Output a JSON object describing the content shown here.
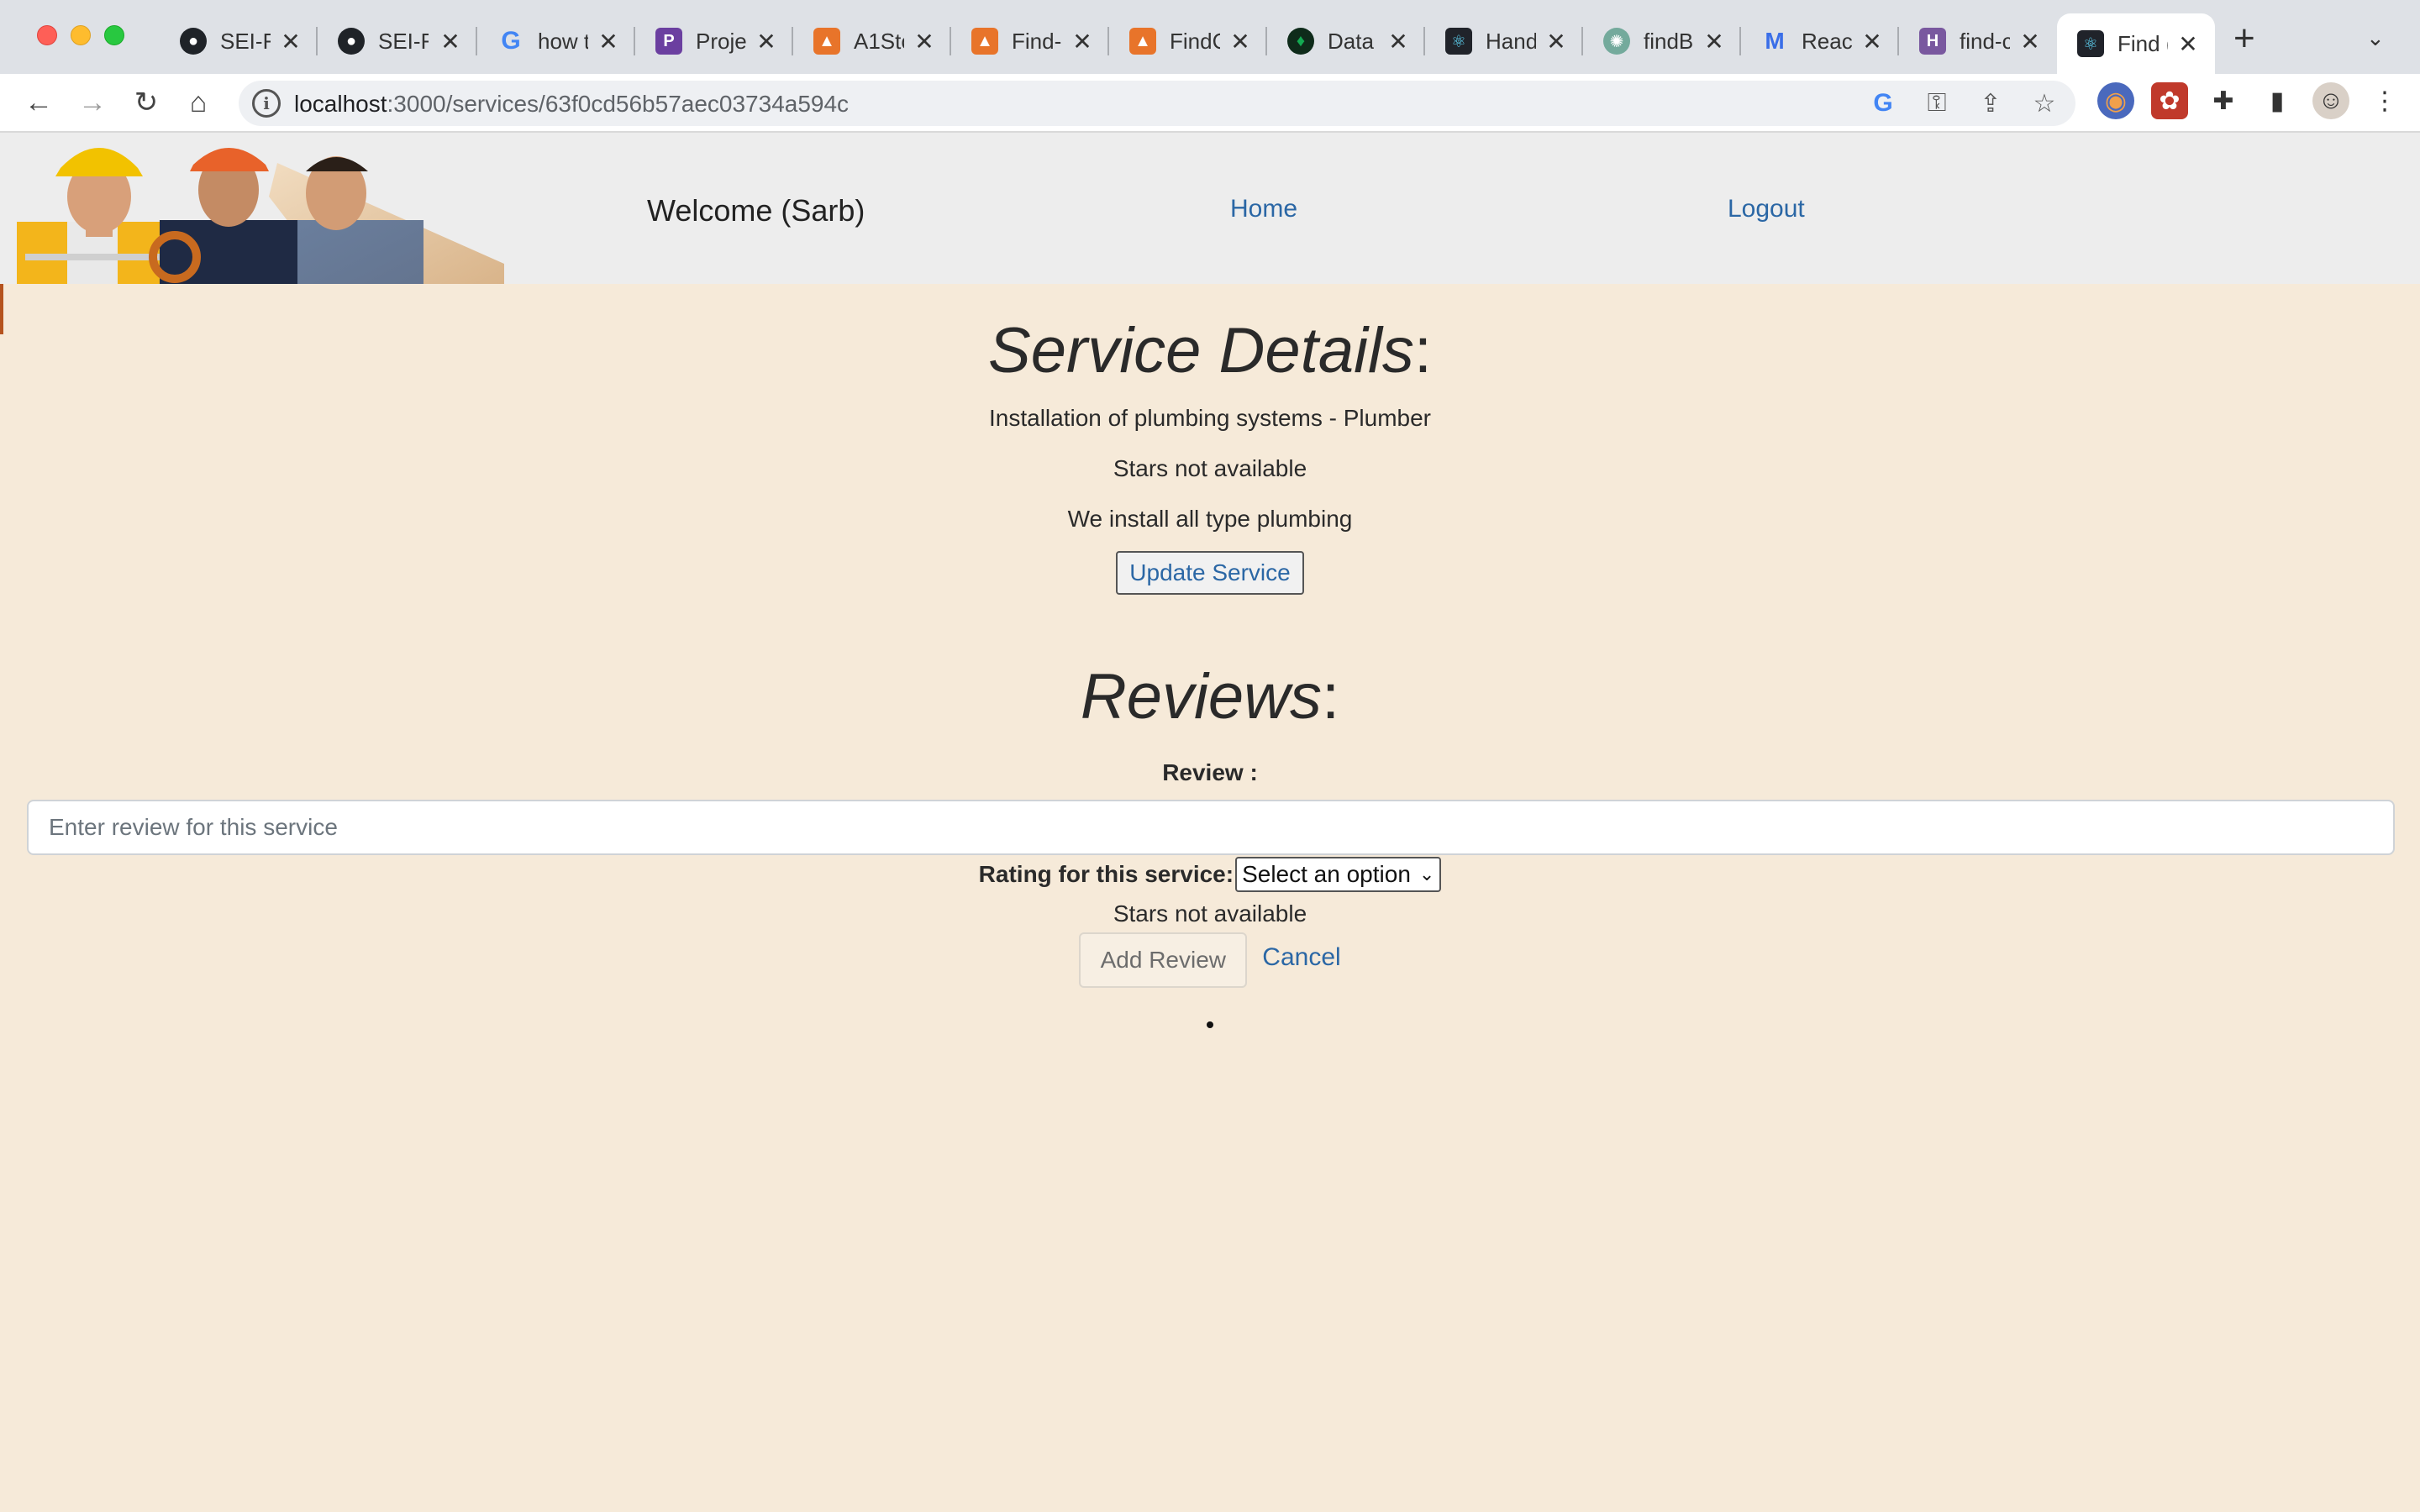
{
  "browser": {
    "tabs": [
      {
        "title": "SEI-F",
        "icon": "github-icon",
        "color": "#1f2328"
      },
      {
        "title": "SEI-F",
        "icon": "github-icon",
        "color": "#1f2328"
      },
      {
        "title": "how t",
        "icon": "google-icon",
        "color": "#4285f4"
      },
      {
        "title": "Proje",
        "icon": "project-icon",
        "color": "#6b3fa0"
      },
      {
        "title": "A1Sto",
        "icon": "find-icon",
        "color": "#e8742a"
      },
      {
        "title": "Find-",
        "icon": "find-icon",
        "color": "#e8742a"
      },
      {
        "title": "FindC",
        "icon": "find-icon",
        "color": "#e8742a"
      },
      {
        "title": "Data",
        "icon": "mongodb-icon",
        "color": "#13aa52"
      },
      {
        "title": "Hand",
        "icon": "react-icon",
        "color": "#61dafb"
      },
      {
        "title": "findB",
        "icon": "chatgpt-icon",
        "color": "#74aa9c"
      },
      {
        "title": "React",
        "icon": "react-icon",
        "color": "#3a6ee8"
      },
      {
        "title": "find-c",
        "icon": "heroku-icon",
        "color": "#79589f"
      },
      {
        "title": "Find (",
        "icon": "react-icon",
        "color": "#61dafb",
        "active": true
      }
    ],
    "url_host": "localhost",
    "url_path": ":3000/services/63f0cd56b57aec03734a594c"
  },
  "nav": {
    "welcome": "Welcome (Sarb)",
    "home": "Home",
    "logout": "Logout"
  },
  "service": {
    "heading": "Service Details",
    "colon": ":",
    "name_line": "Installation of plumbing systems - Plumber",
    "stars": "Stars not available",
    "description": "We install all type plumbing",
    "update_button": "Update Service"
  },
  "reviews": {
    "heading": "Reviews",
    "colon": ":",
    "review_label": "Review :",
    "review_placeholder": "Enter review for this service",
    "rating_label": "Rating for this service:",
    "rating_selected": "Select an option",
    "stars": "Stars not available",
    "add_button": "Add Review",
    "cancel": "Cancel"
  }
}
